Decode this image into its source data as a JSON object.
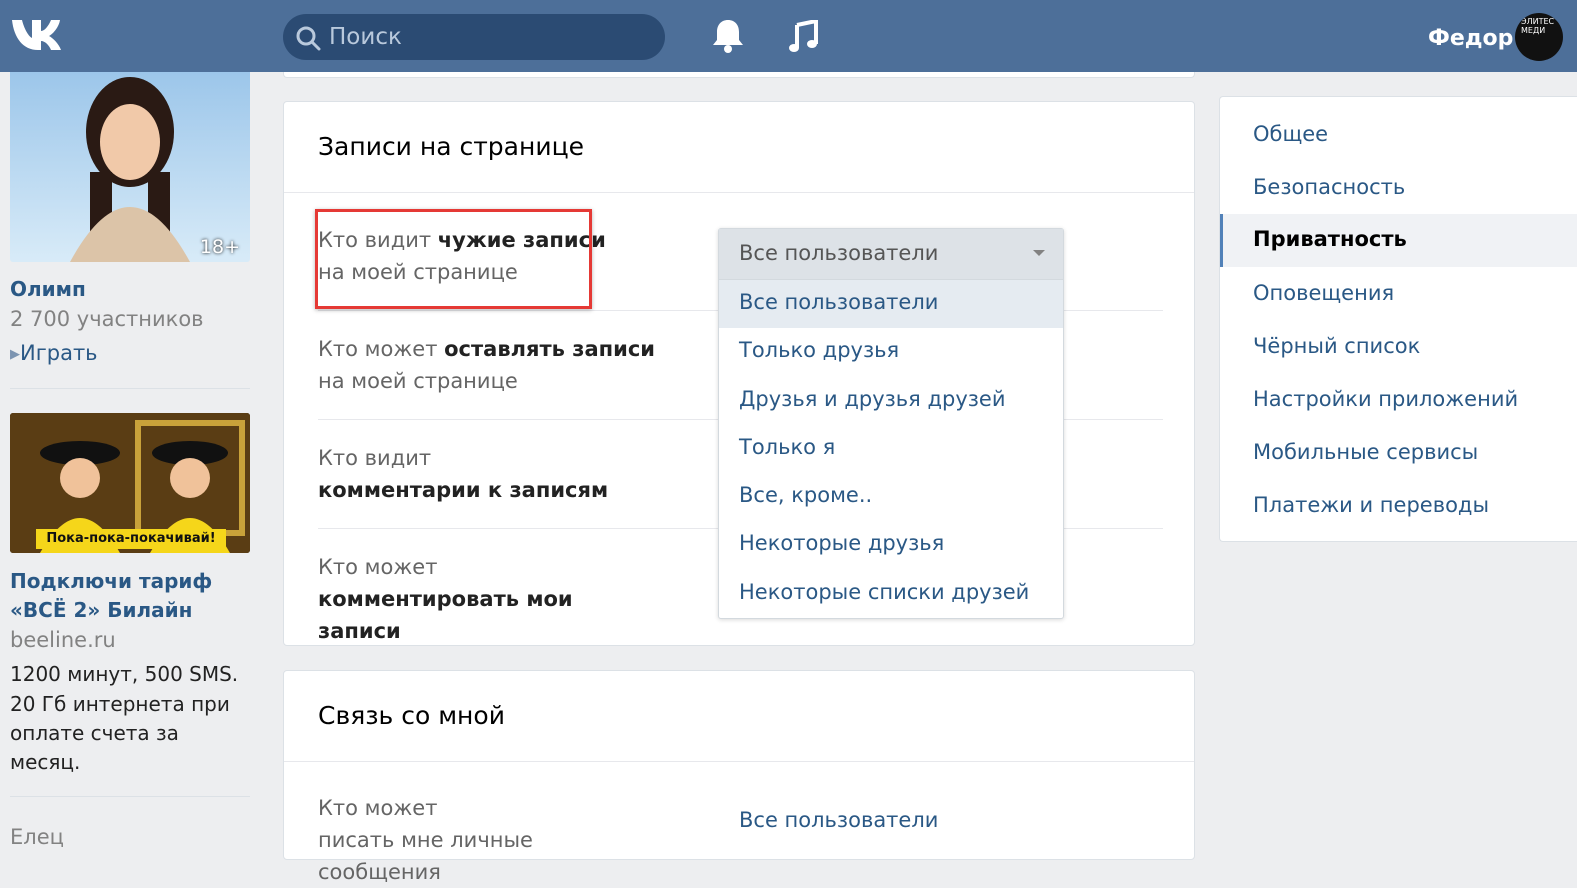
{
  "header": {
    "search_placeholder": "Поиск",
    "user_name": "Федор",
    "avatar_text": "ЭЛИТЕС МЕДИ"
  },
  "left": {
    "ad1": {
      "age_badge": "18+",
      "title": "Олимп",
      "members": "2 700 участников",
      "play_link": "Играть"
    },
    "ad2": {
      "banner": "Пока-пока-покачивай!",
      "title_line1": "Подключи тариф",
      "title_line2": "«ВСЁ 2» Билайн",
      "domain": "beeline.ru",
      "text_line1": "1200 минут, 500 SMS.",
      "text_line2": "20 Гб интернета при",
      "text_line3": "оплате счета за",
      "text_line4": "месяц."
    },
    "cut_text": "Елец"
  },
  "section1": {
    "title": "Записи на странице",
    "rows": [
      {
        "pre": "Кто видит ",
        "bold": "чужие записи",
        "line2": "на моей странице"
      },
      {
        "pre": "Кто может ",
        "bold": "оставлять записи",
        "line2": "на моей странице"
      },
      {
        "pre": "Кто видит",
        "bold": "комментарии к записям"
      },
      {
        "pre": "Кто может",
        "bold": "комментировать мои записи"
      }
    ]
  },
  "dropdown": {
    "selected": "Все пользователи",
    "options": [
      "Все пользователи",
      "Только друзья",
      "Друзья и друзья друзей",
      "Только я",
      "Все, кроме..",
      "Некоторые друзья",
      "Некоторые списки друзей"
    ]
  },
  "section2": {
    "title": "Связь со мной",
    "row_label": "Кто может",
    "row_label2": "писать мне личные сообщения",
    "value": "Все пользователи"
  },
  "nav": {
    "items": [
      "Общее",
      "Безопасность",
      "Приватность",
      "Оповещения",
      "Чёрный список",
      "Настройки приложений",
      "Мобильные сервисы",
      "Платежи и переводы"
    ]
  },
  "colors": {
    "header": "#4d6f99",
    "link": "#2a5885",
    "highlight": "#e53935"
  }
}
